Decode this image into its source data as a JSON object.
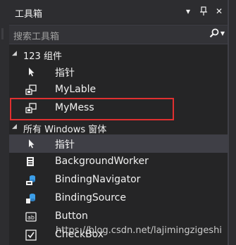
{
  "panel": {
    "title": "工具箱",
    "title_icons": [
      "▾",
      "ᵖ",
      "✕"
    ]
  },
  "search": {
    "placeholder": "搜索工具箱"
  },
  "groups": [
    {
      "label": "123 组件",
      "expanded": true,
      "items": [
        {
          "label": "指针",
          "icon": "pointer-icon"
        },
        {
          "label": "MyLable",
          "icon": "component-icon"
        },
        {
          "label": "MyMess",
          "icon": "component-icon",
          "highlighted": true
        }
      ]
    },
    {
      "label": "所有 Windows 窗体",
      "expanded": true,
      "items": [
        {
          "label": "指针",
          "icon": "pointer-icon",
          "selected": true
        },
        {
          "label": "BackgroundWorker",
          "icon": "background-worker-icon"
        },
        {
          "label": "BindingNavigator",
          "icon": "binding-navigator-icon"
        },
        {
          "label": "BindingSource",
          "icon": "binding-source-icon"
        },
        {
          "label": "Button",
          "icon": "button-icon"
        },
        {
          "label": "CheckBox",
          "icon": "checkbox-icon"
        }
      ]
    }
  ],
  "watermark": "https://blog.csdn.net/lajimingzigeshi",
  "colors": {
    "background": "#252526",
    "titlebar": "#2d2d30",
    "selection": "#3f3f46",
    "highlight_box": "#e03030"
  }
}
